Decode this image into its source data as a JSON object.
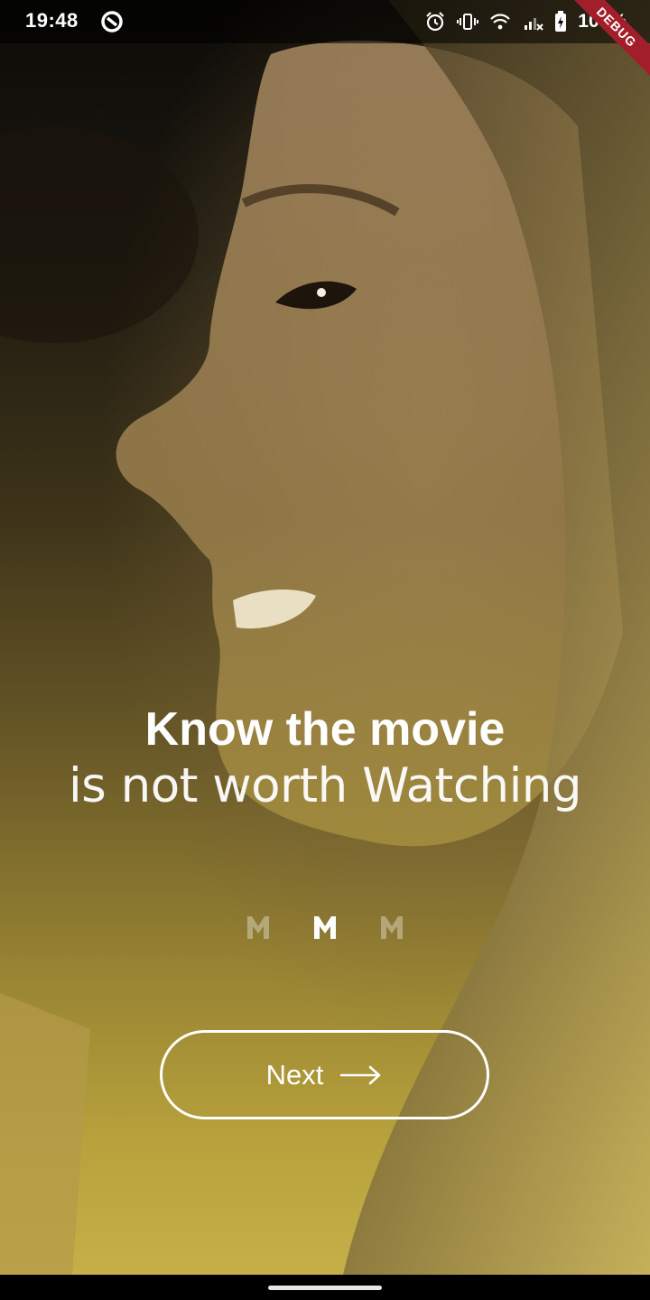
{
  "status_bar": {
    "time": "19:48",
    "battery_text": "100%",
    "icons": [
      "sync-circle-icon",
      "alarm-icon",
      "vibrate-icon",
      "wifi-icon",
      "signal-icon",
      "battery-charging-icon"
    ]
  },
  "debug_banner": "DEBUG",
  "onboarding": {
    "title_bold": "Know the movie",
    "title_light": "is not worth Watching",
    "page_indicator": {
      "count": 3,
      "active_index": 1,
      "icon": "m-logo-icon"
    },
    "next_button": {
      "label": "Next",
      "icon": "arrow-right-icon"
    }
  },
  "colors": {
    "overlay_bottom": "#c8b24a",
    "overlay_top": "#0b0a07",
    "debug_ribbon": "#a31e2b",
    "text": "#ffffff"
  }
}
